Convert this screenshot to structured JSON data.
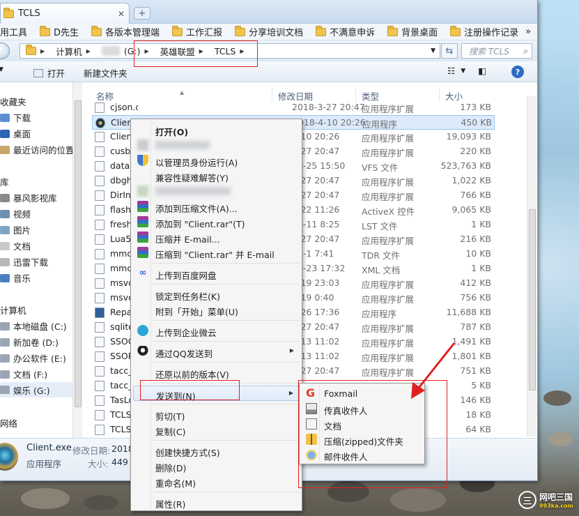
{
  "window": {
    "tab_title": "TCLS",
    "tab_close_glyph": "✕",
    "new_tab_glyph": "+"
  },
  "bookmarks": {
    "items": [
      "用工具",
      "D先生",
      "各版本管理端",
      "工作汇报",
      "分享培训文档",
      "不满意申诉",
      "背景桌面",
      "注册操作记录"
    ],
    "more_glyph": "»"
  },
  "address": {
    "segments": [
      "计算机",
      "(G:)",
      "英雄联盟",
      "TCLS"
    ],
    "search_placeholder": "搜索 TCLS"
  },
  "toolbar": {
    "open_label": "打开",
    "new_folder_label": "新建文件夹"
  },
  "nav": {
    "favorites_header": "收藏夹",
    "favorites": [
      "下载",
      "桌面",
      "最近访问的位置"
    ],
    "libraries_header": "库",
    "libraries": [
      "暴风影视库",
      "视频",
      "图片",
      "文档",
      "迅雷下载",
      "音乐"
    ],
    "computer_header": "计算机",
    "drives": [
      "本地磁盘 (C:)",
      "新加卷 (D:)",
      "办公软件 (E:)",
      "文档 (F:)",
      "娱乐 (G:)"
    ],
    "network_header": "网络"
  },
  "columns": {
    "name": "名称",
    "date": "修改日期",
    "type": "类型",
    "size": "大小"
  },
  "files": [
    {
      "name": "cjson.dll",
      "date": "2018-3-27 20:47",
      "type": "应用程序扩展",
      "size": "173 KB"
    },
    {
      "name": "Client.exe",
      "date": "2018-4-10 20:26",
      "type": "应用程序",
      "size": "450 KB"
    },
    {
      "name": "Client",
      "date": "4-10 20:26",
      "type": "应用程序扩展",
      "size": "19,093 KB"
    },
    {
      "name": "cusb",
      "date": "3-27 20:47",
      "type": "应用程序扩展",
      "size": "220 KB"
    },
    {
      "name": "data.",
      "date": "10-25 15:50",
      "type": "VFS 文件",
      "size": "523,763 KB"
    },
    {
      "name": "dbgh",
      "date": "3-27 20:47",
      "type": "应用程序扩展",
      "size": "1,022 KB"
    },
    {
      "name": "DirIn",
      "date": "3-27 20:47",
      "type": "应用程序扩展",
      "size": "766 KB"
    },
    {
      "name": "flash",
      "date": "1-22 11:26",
      "type": "ActiveX 控件",
      "size": "9,065 KB"
    },
    {
      "name": "fresh",
      "date": "10-11 8:25",
      "type": "LST 文件",
      "size": "1 KB"
    },
    {
      "name": "Lua5",
      "date": "3-27 20:47",
      "type": "应用程序扩展",
      "size": "216 KB"
    },
    {
      "name": "mmc",
      "date": "12-1 7:41",
      "type": "TDR 文件",
      "size": "10 KB"
    },
    {
      "name": "mmc",
      "date": "10-23 17:32",
      "type": "XML 文档",
      "size": "1 KB"
    },
    {
      "name": "msvc",
      "date": "2-19 23:03",
      "type": "应用程序扩展",
      "size": "412 KB"
    },
    {
      "name": "msvc",
      "date": "2-19 0:40",
      "type": "应用程序扩展",
      "size": "756 KB"
    },
    {
      "name": "Repa",
      "date": "7-26 17:36",
      "type": "应用程序",
      "size": "11,688 KB"
    },
    {
      "name": "sqlite",
      "date": "3-27 20:47",
      "type": "应用程序扩展",
      "size": "787 KB"
    },
    {
      "name": "SSOC",
      "date": "4-13 11:02",
      "type": "应用程序扩展",
      "size": "1,491 KB"
    },
    {
      "name": "SSOP",
      "date": "4-13 11:02",
      "type": "应用程序扩展",
      "size": "1,801 KB"
    },
    {
      "name": "tacc_",
      "date": "3-27 20:47",
      "type": "应用程序扩展",
      "size": "751 KB"
    },
    {
      "name": "tacc_",
      "date": "",
      "type": "",
      "size": "5 KB"
    },
    {
      "name": "TasLo",
      "date": "",
      "type": "",
      "size": "146 KB"
    },
    {
      "name": "TCLS",
      "date": "",
      "type": "",
      "size": "18 KB"
    },
    {
      "name": "TCLS",
      "date": "",
      "type": "",
      "size": "64 KB"
    }
  ],
  "details": {
    "name": "Client.exe",
    "type": "应用程序",
    "modified_label": "修改日期:",
    "modified_value": "2018",
    "size_label": "大小:",
    "size_value": "449 I"
  },
  "context_menu": {
    "open": "打开(O)",
    "run_as_admin": "以管理员身份运行(A)",
    "compat": "兼容性疑难解答(Y)",
    "add_archive": "添加到压缩文件(A)...",
    "add_client_rar": "添加到 \"Client.rar\"(T)",
    "compress_email": "压缩并 E-mail...",
    "compress_rar_email": "压缩到 \"Client.rar\" 并 E-mail",
    "baidu": "上传到百度网盘",
    "pin_taskbar": "锁定到任务栏(K)",
    "pin_start": "附到「开始」菜单(U)",
    "wechat_work": "上传到企业微云",
    "send_qq": "通过QQ发送到",
    "restore": "还原以前的版本(V)",
    "send_to": "发送到(N)",
    "cut": "剪切(T)",
    "copy": "复制(C)",
    "shortcut": "创建快捷方式(S)",
    "delete": "删除(D)",
    "rename": "重命名(M)",
    "properties": "属性(R)"
  },
  "send_to_menu": {
    "foxmail": "Foxmail",
    "fax": "传真收件人",
    "documents": "文档",
    "zip": "压缩(zipped)文件夹",
    "mail": "邮件收件人"
  },
  "watermark": {
    "text": "网吧三国",
    "sub": "993ka.com"
  },
  "colors": {
    "annotation": "#e02020",
    "selection": "#dcebfb",
    "accent": "#2d6cc4"
  }
}
